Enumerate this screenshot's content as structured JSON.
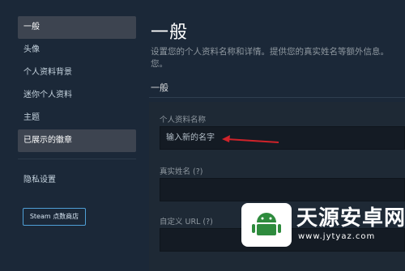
{
  "sidebar": {
    "items": [
      {
        "label": "一般",
        "active": true
      },
      {
        "label": "头像",
        "active": false
      },
      {
        "label": "个人资料背景",
        "active": false
      },
      {
        "label": "迷你个人资料",
        "active": false
      },
      {
        "label": "主题",
        "active": false
      },
      {
        "label": "已展示的徽章",
        "active": true
      }
    ],
    "privacy_label": "隐私设置",
    "store_button": "Steam 点数商店"
  },
  "main": {
    "title": "一般",
    "description": "设置您的个人资料名称和详情。提供您的真实姓名等额外信息。",
    "description_cont": "您。",
    "section_title": "一般",
    "fields": {
      "profile_name_label": "个人资料名称",
      "profile_name_placeholder": "输入新的名字",
      "real_name_label": "真实姓名 (?)",
      "custom_url_label": "自定义 URL (?)"
    }
  },
  "watermark": {
    "title": "天源安卓网",
    "url": "www.jytyaz.com"
  },
  "colors": {
    "background": "#1b2838",
    "active_item": "#3d4450",
    "button_border": "#4f9fd6",
    "arrow": "#d0232a"
  }
}
